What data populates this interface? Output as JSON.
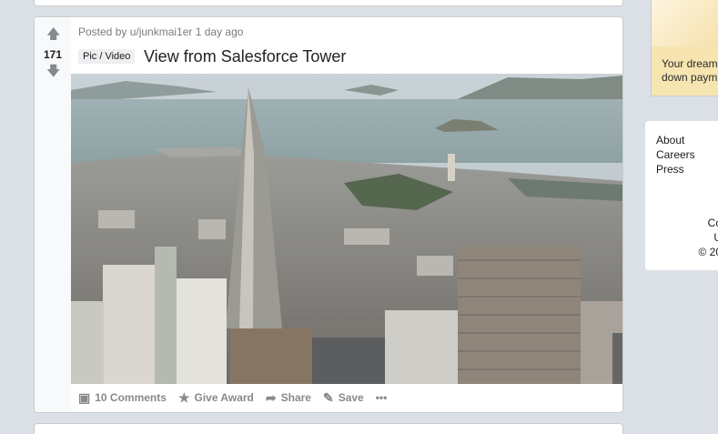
{
  "post": {
    "score": "171",
    "meta": "Posted by u/junkmai1er 1 day ago",
    "flair": "Pic / Video",
    "title": "View from Salesforce Tower",
    "actions": {
      "comments": "10 Comments",
      "award": "Give Award",
      "share": "Share",
      "save": "Save",
      "more": "•••"
    }
  },
  "sidebar": {
    "ad_text": "Your dream down paym",
    "footer_links": [
      "About",
      "Careers",
      "Press"
    ],
    "footer_copy": [
      "Co",
      "U",
      "© 20"
    ]
  },
  "icons": {
    "upvote": "arrow-up-icon",
    "downvote": "arrow-down-icon",
    "comments": "comment-icon",
    "award": "award-icon",
    "share": "share-icon",
    "save": "bookmark-icon",
    "more": "more-dots-icon"
  }
}
